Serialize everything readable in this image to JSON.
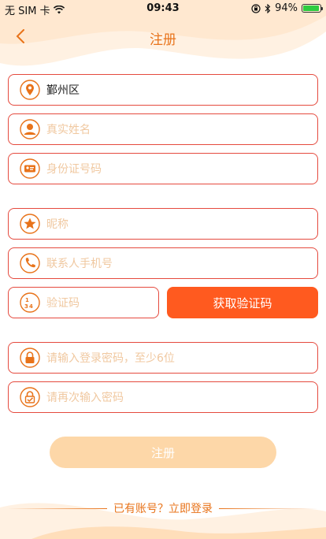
{
  "status_bar": {
    "carrier": "无 SIM 卡",
    "time": "09:43",
    "battery_percent": "94%",
    "battery_level": 0.94
  },
  "nav": {
    "title": "注册"
  },
  "form": {
    "region_value": "鄞州区",
    "real_name_placeholder": "真实姓名",
    "id_number_placeholder": "身份证号码",
    "nickname_placeholder": "昵称",
    "phone_placeholder": "联系人手机号",
    "code_placeholder": "验证码",
    "get_code_label": "获取验证码",
    "password_placeholder": "请输入登录密码，至少6位",
    "confirm_password_placeholder": "请再次输入密码"
  },
  "submit_label": "注册",
  "login_prompt": "已有账号？立即登录",
  "colors": {
    "accent": "#e8731a",
    "field_border": "#e54a3e",
    "code_button": "#ff5a1f",
    "submit_disabled": "#fdd7a8",
    "placeholder": "#f0c8a0"
  },
  "icons": {
    "region": "location-pin-icon",
    "real_name": "user-icon",
    "id_number": "id-card-icon",
    "nickname": "star-icon",
    "phone": "phone-icon",
    "code": "number-code-icon",
    "password": "lock-icon",
    "confirm_password": "lock-check-icon"
  }
}
